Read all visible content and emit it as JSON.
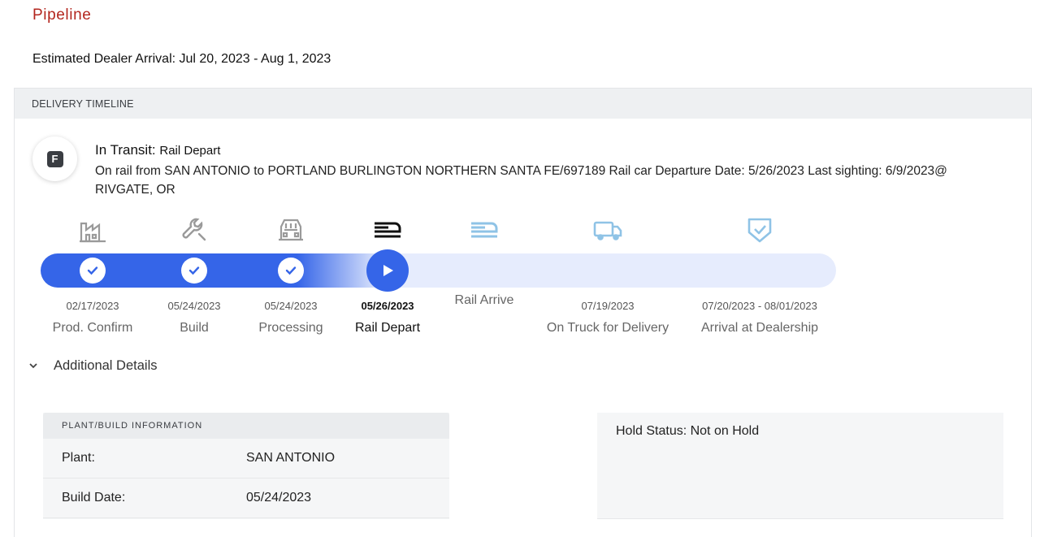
{
  "page": {
    "title": "Pipeline",
    "eta_label": "Estimated Dealer Arrival: Jul 20, 2023 - Aug 1, 2023"
  },
  "timeline": {
    "header": "DELIVERY TIMELINE",
    "badge_letter": "F",
    "status_prefix": "In Transit:",
    "status_value": "Rail Depart",
    "status_description": "On rail from SAN ANTONIO to PORTLAND BURLINGTON NORTHERN SANTA FE/697189 Rail car Departure Date: 5/26/2023 Last sighting: 6/9/2023@ RIVGATE, OR",
    "progress_fraction": 0.43,
    "steps": [
      {
        "label": "Prod. Confirm",
        "date": "02/17/2023",
        "state": "done",
        "icon": "factory-icon"
      },
      {
        "label": "Build",
        "date": "05/24/2023",
        "state": "done",
        "icon": "wrench-icon"
      },
      {
        "label": "Processing",
        "date": "05/24/2023",
        "state": "done",
        "icon": "car-front-icon"
      },
      {
        "label": "Rail Depart",
        "date": "05/26/2023",
        "state": "current",
        "icon": "rail-icon"
      },
      {
        "label": "Rail Arrive",
        "date": "",
        "state": "pending",
        "icon": "rail-icon"
      },
      {
        "label": "On Truck for Delivery",
        "date": "07/19/2023",
        "state": "pending",
        "icon": "truck-icon"
      },
      {
        "label": "Arrival at Dealership",
        "date": "07/20/2023 - 08/01/2023",
        "state": "pending",
        "icon": "shield-check-icon"
      }
    ],
    "colors": {
      "progress": "#3565e8",
      "track": "#e6ecfd",
      "done_icon": "#9a9a9a",
      "pending_icon": "#8fc3e6",
      "title": "#b3261e"
    }
  },
  "details": {
    "toggle_label": "Additional Details",
    "plant": {
      "header": "PLANT/BUILD INFORMATION",
      "rows": [
        {
          "key": "Plant:",
          "value": "SAN ANTONIO"
        },
        {
          "key": "Build Date:",
          "value": "05/24/2023"
        }
      ]
    },
    "hold_status": "Hold Status: Not on Hold"
  }
}
